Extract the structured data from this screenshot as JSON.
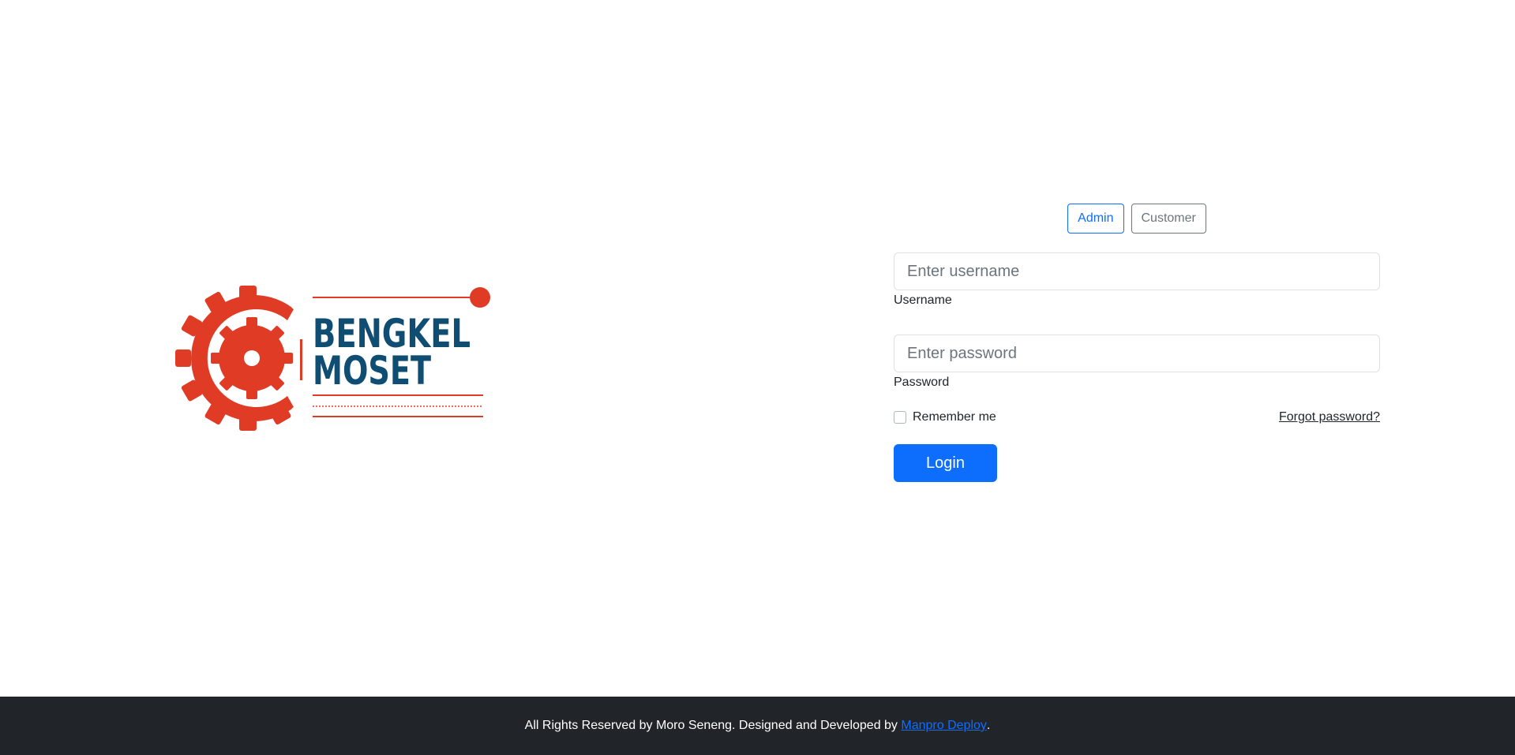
{
  "logo": {
    "line1": "BENGKEL",
    "line2": "MOSET",
    "accent_color": "#e03b24",
    "text_color": "#0f4d73"
  },
  "login": {
    "roles": [
      {
        "label": "Admin",
        "active": true
      },
      {
        "label": "Customer",
        "active": false
      }
    ],
    "username": {
      "placeholder": "Enter username",
      "value": "",
      "label": "Username"
    },
    "password": {
      "placeholder": "Enter password",
      "value": "",
      "label": "Password"
    },
    "remember_label": "Remember me",
    "remember_checked": false,
    "forgot_label": "Forgot password?",
    "submit_label": "Login"
  },
  "footer": {
    "text": "All Rights Reserved by Moro Seneng. Designed and Developed by",
    "link_label": "Manpro Deploy",
    "suffix": "."
  },
  "colors": {
    "primary": "#0d6efd",
    "secondary": "#6c757d",
    "footer_bg": "#212529"
  }
}
